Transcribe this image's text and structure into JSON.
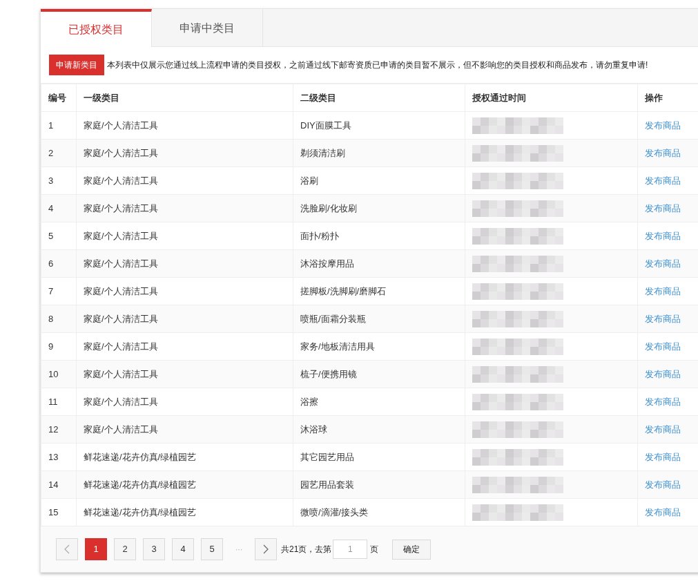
{
  "tabs": [
    {
      "label": "已授权类目",
      "selected": true
    },
    {
      "label": "申请中类目",
      "selected": false
    }
  ],
  "apply_button": "申请新类目",
  "notice": "本列表中仅展示您通过线上流程申请的类目授权，之前通过线下邮寄资质已申请的类目暂不展示，但不影响您的类目授权和商品发布，请勿重复申请!",
  "table": {
    "columns": [
      "编号",
      "一级类目",
      "二级类目",
      "授权通过时间",
      "操作"
    ],
    "rows": [
      {
        "number": "1",
        "category_1": "家庭/个人清洁工具",
        "category_2": "DIY面膜工具",
        "action": "发布商品"
      },
      {
        "number": "2",
        "category_1": "家庭/个人清洁工具",
        "category_2": "剃须清洁刷",
        "action": "发布商品"
      },
      {
        "number": "3",
        "category_1": "家庭/个人清洁工具",
        "category_2": "浴刷",
        "action": "发布商品"
      },
      {
        "number": "4",
        "category_1": "家庭/个人清洁工具",
        "category_2": "洗脸刷/化妆刷",
        "action": "发布商品"
      },
      {
        "number": "5",
        "category_1": "家庭/个人清洁工具",
        "category_2": "面扑/粉扑",
        "action": "发布商品"
      },
      {
        "number": "6",
        "category_1": "家庭/个人清洁工具",
        "category_2": "沐浴按摩用品",
        "action": "发布商品"
      },
      {
        "number": "7",
        "category_1": "家庭/个人清洁工具",
        "category_2": "搓脚板/洗脚刷/磨脚石",
        "action": "发布商品"
      },
      {
        "number": "8",
        "category_1": "家庭/个人清洁工具",
        "category_2": "喷瓶/面霜分装瓶",
        "action": "发布商品"
      },
      {
        "number": "9",
        "category_1": "家庭/个人清洁工具",
        "category_2": "家务/地板清洁用具",
        "action": "发布商品"
      },
      {
        "number": "10",
        "category_1": "家庭/个人清洁工具",
        "category_2": "梳子/便携用镜",
        "action": "发布商品"
      },
      {
        "number": "11",
        "category_1": "家庭/个人清洁工具",
        "category_2": "浴擦",
        "action": "发布商品"
      },
      {
        "number": "12",
        "category_1": "家庭/个人清洁工具",
        "category_2": "沐浴球",
        "action": "发布商品"
      },
      {
        "number": "13",
        "category_1": "鲜花速递/花卉仿真/绿植园艺",
        "category_2": "其它园艺用品",
        "action": "发布商品"
      },
      {
        "number": "14",
        "category_1": "鲜花速递/花卉仿真/绿植园艺",
        "category_2": "园艺用品套装",
        "action": "发布商品"
      },
      {
        "number": "15",
        "category_1": "鲜花速递/花卉仿真/绿植园艺",
        "category_2": "微喷/滴灌/接头类",
        "action": "发布商品"
      }
    ]
  },
  "pagination": {
    "pages": [
      {
        "label": "1",
        "selected": true
      },
      {
        "label": "2",
        "selected": false
      },
      {
        "label": "3",
        "selected": false
      },
      {
        "label": "4",
        "selected": false
      },
      {
        "label": "5",
        "selected": false
      }
    ],
    "ellipsis": "···",
    "total_text": "共21页，去第",
    "page_input": "1",
    "page_suffix": "页",
    "confirm": "确定"
  }
}
